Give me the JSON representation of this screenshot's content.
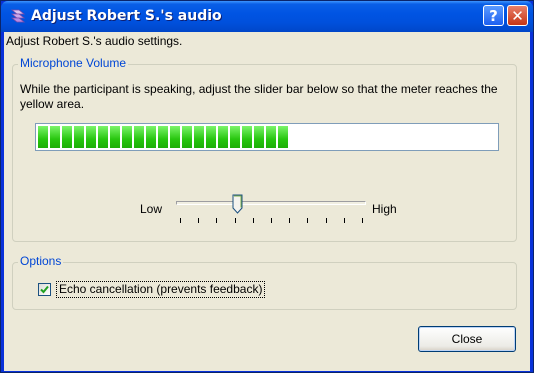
{
  "window": {
    "title": "Adjust Robert S.'s audio",
    "help_glyph": "?",
    "close_glyph": "✕"
  },
  "intro_text": "Adjust Robert S.'s audio settings.",
  "microphone": {
    "group_label": "Microphone Volume",
    "instructions": "While the participant is speaking, adjust the slider bar below so that the meter reaches the yellow area.",
    "meter_level": 0.55,
    "meter_color": "#28c60e",
    "slider": {
      "low_label": "Low",
      "high_label": "High",
      "value": 0.32
    }
  },
  "options": {
    "group_label": "Options",
    "echo_cancellation": {
      "label": "Echo cancellation (prevents feedback)",
      "checked": true
    }
  },
  "buttons": {
    "close_label": "Close"
  },
  "colors": {
    "titlebar": "#0054e3",
    "group_label": "#0046d5",
    "dialog_bg": "#ece9d8"
  }
}
